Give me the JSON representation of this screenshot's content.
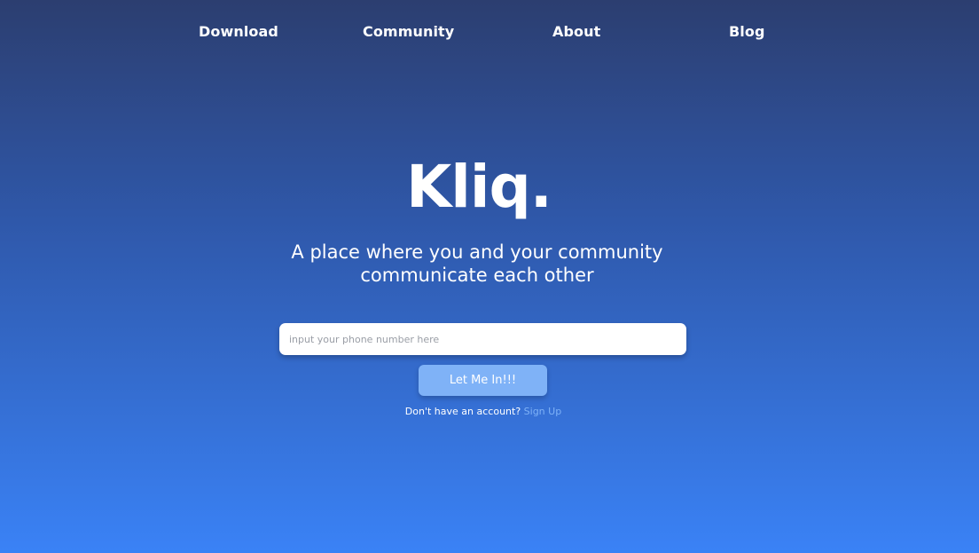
{
  "nav": {
    "items": [
      {
        "label": "Download"
      },
      {
        "label": "Community"
      },
      {
        "label": "About"
      },
      {
        "label": "Blog"
      }
    ]
  },
  "hero": {
    "logo": "Kliq.",
    "tagline_line1": "A place where you and your community",
    "tagline_line2": "communicate each other"
  },
  "form": {
    "phone_placeholder": "input your phone number here",
    "phone_value": "",
    "submit_label": "Let Me In!!!"
  },
  "signup": {
    "prompt": "Don't have an account?",
    "link_label": "Sign Up"
  },
  "colors": {
    "background_top": "#2c3e70",
    "background_bottom": "#3a82f6",
    "button": "#7fb2f7",
    "link": "#7fb2f7"
  }
}
